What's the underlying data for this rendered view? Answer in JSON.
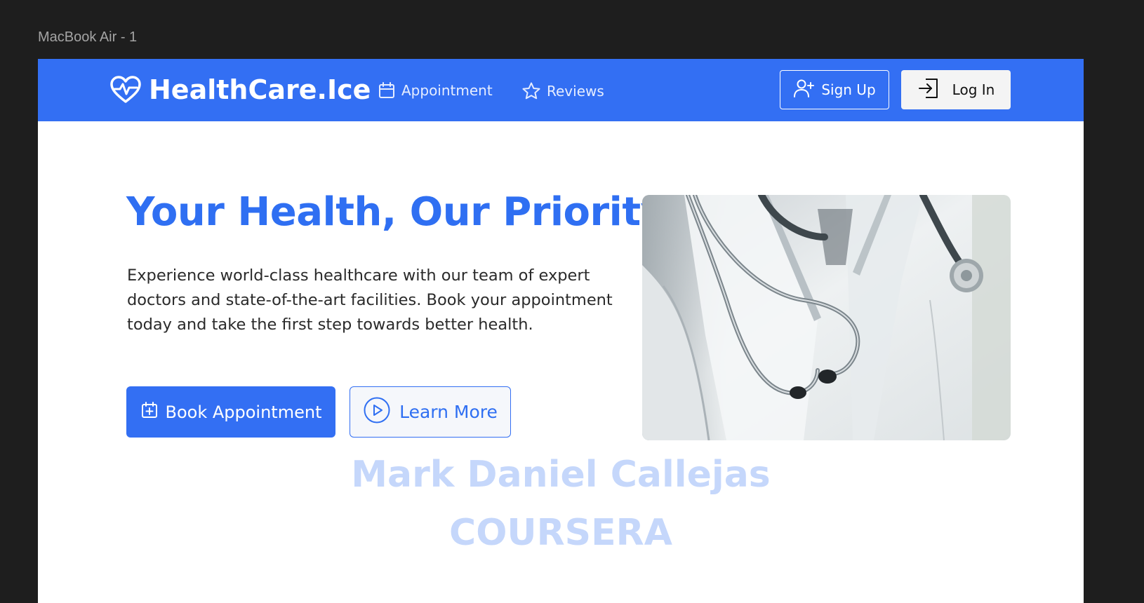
{
  "frame": {
    "label": "MacBook Air - 1"
  },
  "navbar": {
    "brand": {
      "name": "HealthCare.Ice",
      "icon": "heart-pulse-icon"
    },
    "links": [
      {
        "label": "Appointment",
        "icon": "calendar-icon"
      },
      {
        "label": "Reviews",
        "icon": "star-icon"
      }
    ],
    "signup_label": "Sign Up",
    "login_label": "Log In"
  },
  "hero": {
    "title": "Your Health, Our Priority",
    "description": "Experience world-class healthcare with our team of expert doctors and state-of-the-art facilities. Book your appointment today and take the first step towards better health.",
    "book_label": "Book Appointment",
    "learn_label": "Learn More",
    "image_subject": "doctor-with-stethoscope"
  },
  "watermark": {
    "name": "Mark Daniel Callejas",
    "org": "COURSERA"
  },
  "colors": {
    "brand_blue": "#336ff3",
    "title_blue": "#2f6ff2",
    "watermark": "#c5d7fb",
    "canvas": "#1e1e1e"
  }
}
